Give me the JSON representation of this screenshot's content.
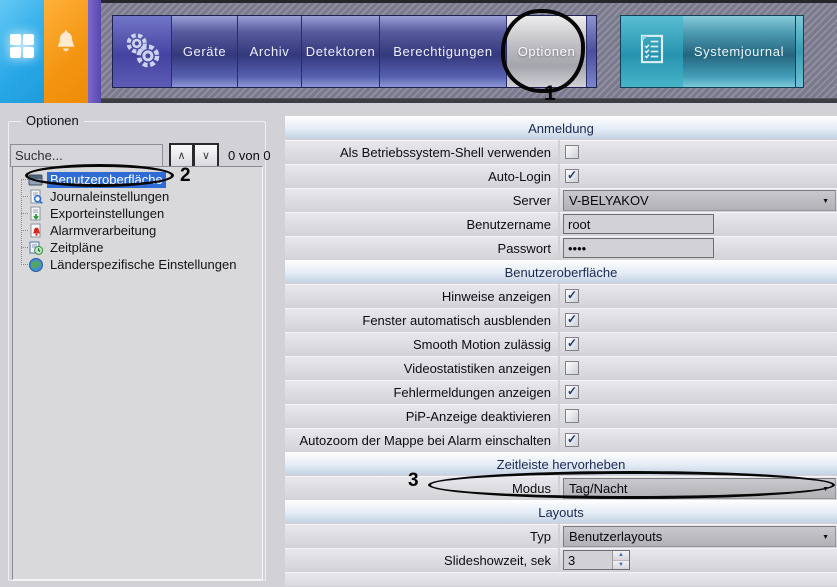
{
  "topbar": {
    "tabs": [
      {
        "icon": "apps-grid-icon"
      },
      {
        "icon": "alarm-bell-icon"
      }
    ],
    "nav": {
      "gears_icon": "settings-gears-icon",
      "items": [
        {
          "label": "Geräte"
        },
        {
          "label": "Archiv"
        },
        {
          "label": "Detektoren"
        },
        {
          "label": "Berechtigungen"
        },
        {
          "label": "Optionen",
          "selected": true
        }
      ]
    },
    "systemjournal": {
      "icon": "journal-checklist-icon",
      "label": "Systemjournal"
    }
  },
  "annotations": {
    "step1": "1",
    "step2": "2",
    "step3": "3"
  },
  "sidebar": {
    "group_title": "Optionen",
    "search": {
      "placeholder": "Suche...",
      "count": "0 von 0"
    },
    "tree": [
      {
        "label": "Benutzeroberfläche",
        "icon": "window-icon",
        "selected": true
      },
      {
        "label": "Journaleinstellungen",
        "icon": "journal-search-icon",
        "selected": false
      },
      {
        "label": "Exporteinstellungen",
        "icon": "export-icon",
        "selected": false
      },
      {
        "label": "Alarmverarbeitung",
        "icon": "alarm-doc-icon",
        "selected": false
      },
      {
        "label": "Zeitpläne",
        "icon": "schedule-icon",
        "selected": false
      },
      {
        "label": "Länderspezifische Einstellungen",
        "icon": "globe-icon",
        "selected": false
      }
    ]
  },
  "settings": {
    "entries": [
      {
        "type": "header",
        "label": "Anmeldung"
      },
      {
        "type": "checkbox",
        "label": "Als Betriebssystem-Shell verwenden",
        "checked": false
      },
      {
        "type": "checkbox",
        "label": "Auto-Login",
        "checked": true
      },
      {
        "type": "select",
        "label": "Server",
        "value": "V-BELYAKOV"
      },
      {
        "type": "text",
        "label": "Benutzername",
        "value": "root"
      },
      {
        "type": "password",
        "label": "Passwort",
        "value": "••••"
      },
      {
        "type": "header",
        "label": "Benutzeroberfläche"
      },
      {
        "type": "checkbox",
        "label": "Hinweise anzeigen",
        "checked": true
      },
      {
        "type": "checkbox",
        "label": "Fenster automatisch ausblenden",
        "checked": true
      },
      {
        "type": "checkbox",
        "label": "Smooth Motion zulässig",
        "checked": true
      },
      {
        "type": "checkbox",
        "label": "Videostatistiken anzeigen",
        "checked": false
      },
      {
        "type": "checkbox",
        "label": "Fehlermeldungen anzeigen",
        "checked": true
      },
      {
        "type": "checkbox",
        "label": "PiP-Anzeige deaktivieren",
        "checked": false
      },
      {
        "type": "checkbox",
        "label": "Autozoom der Mappe bei Alarm einschalten",
        "checked": true
      },
      {
        "type": "header",
        "label": "Zeitleiste hervorheben"
      },
      {
        "type": "select",
        "label": "Modus",
        "value": "Tag/Nacht"
      },
      {
        "type": "header",
        "label": "Layouts"
      },
      {
        "type": "select",
        "label": "Typ",
        "value": "Benutzerlayouts"
      },
      {
        "type": "spinner",
        "label": "Slideshowzeit, sek",
        "value": "3"
      }
    ]
  },
  "colors": {
    "selection_blue": "#2e6bd4",
    "toolbar_blue": "#34387c",
    "journal_teal": "#25657f",
    "tab_blue": "#28a7e6",
    "tab_orange": "#f39410",
    "annotation": "#070707"
  }
}
